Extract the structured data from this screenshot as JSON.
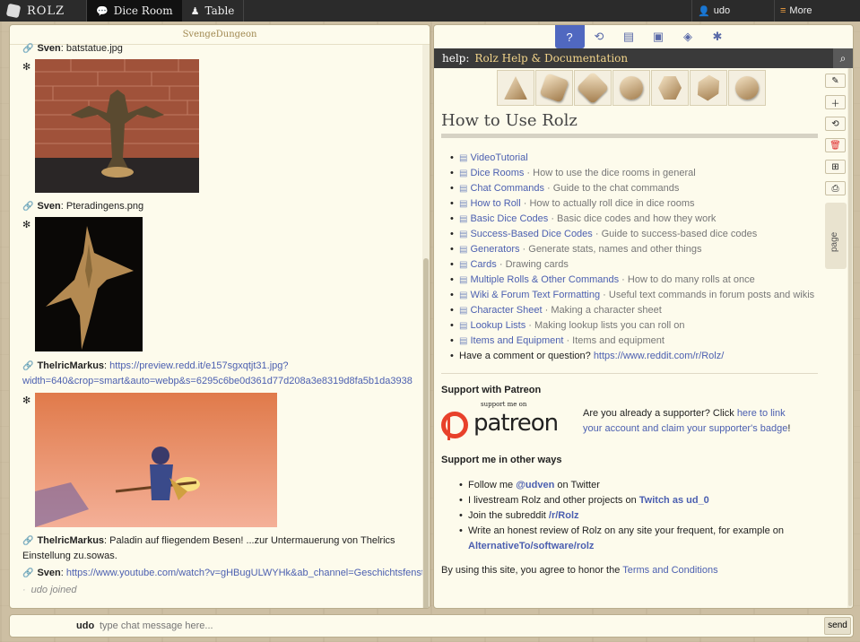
{
  "topbar": {
    "logo": "ROLZ",
    "tabs": [
      {
        "label": "Dice Room",
        "icon": "chat-bubble-icon",
        "active": true
      },
      {
        "label": "Table",
        "icon": "chess-piece-icon",
        "active": false
      }
    ],
    "user": "udo",
    "more": "More"
  },
  "chat": {
    "room_name": "SvengeDungeon",
    "messages": [
      {
        "author": "Sven",
        "text": "batstatue.jpg"
      },
      {
        "author": "Sven",
        "text": "Pteradingens.png"
      },
      {
        "author": "ThelricMarkus",
        "link_line1": "https://preview.redd.it/e157sgxqtjt31.jpg?",
        "link_line2": "width=640&crop=smart&auto=webp&s=6295c6be0d361d77d208a3e8319d8fa5b1da3938"
      },
      {
        "author": "ThelricMarkus",
        "line1": "Paladin auf fliegendem Besen! ...zur Untermauerung von Thelrics",
        "line2": "Einstellung zu.sowas."
      },
      {
        "author": "Sven",
        "link": "https://www.youtube.com/watch?v=gHBugULWYHk&ab_channel=Geschichtsfenster"
      }
    ],
    "joined": "udo joined"
  },
  "help": {
    "title_prefix": "help:",
    "title": "Rolz Help & Documentation",
    "heading": "How to Use Rolz",
    "items": [
      {
        "link": "VideoTutorial",
        "desc": ""
      },
      {
        "link": "Dice Rooms",
        "desc": " · How to use the dice rooms in general"
      },
      {
        "link": "Chat Commands",
        "desc": " · Guide to the chat commands"
      },
      {
        "link": "How to Roll",
        "desc": " · How to actually roll dice in dice rooms"
      },
      {
        "link": "Basic Dice Codes",
        "desc": " · Basic dice codes and how they work"
      },
      {
        "link": "Success-Based Dice Codes",
        "desc": " · Guide to success-based dice codes"
      },
      {
        "link": "Generators",
        "desc": " · Generate stats, names and other things"
      },
      {
        "link": "Cards",
        "desc": " · Drawing cards"
      },
      {
        "link": "Multiple Rolls & Other Commands",
        "desc": " · How to do many rolls at once"
      },
      {
        "link": "Wiki & Forum Text Formatting",
        "desc": " · Useful text commands in forum posts and wikis"
      },
      {
        "link": "Character Sheet",
        "desc": " · Making a character sheet"
      },
      {
        "link": "Lookup Lists",
        "desc": " · Making lookup lists you can roll on"
      },
      {
        "link": "Items and Equipment",
        "desc": " · Items and equipment"
      }
    ],
    "question_text": "Have a comment or question?",
    "question_link": "https://www.reddit.com/r/Rolz/",
    "patreon_title": "Support with Patreon",
    "patreon_small": "support me on",
    "patreon_word": "patreon",
    "patreon_text1": "Are you already a supporter? Click ",
    "patreon_link": "here to link your account and claim your supporter's badge",
    "patreon_text2": "!",
    "other_title": "Support me in other ways",
    "other": [
      {
        "pre": "Follow me ",
        "link": "@udven",
        "post": " on Twitter"
      },
      {
        "pre": "I livestream Rolz and other projects on ",
        "link": "Twitch as ud_0",
        "post": ""
      },
      {
        "pre": "Join the subreddit ",
        "link": "/r/Rolz",
        "post": ""
      },
      {
        "pre": "Write an honest review of Rolz on any site your frequent, for example on ",
        "link": "AlternativeTo/software/rolz",
        "post": ""
      }
    ],
    "terms_pre": "By using this site, you agree to honor the ",
    "terms_link": "Terms and Conditions",
    "page_tab": "page"
  },
  "input": {
    "user": "udo",
    "placeholder": "type chat message here...",
    "send": "send"
  }
}
